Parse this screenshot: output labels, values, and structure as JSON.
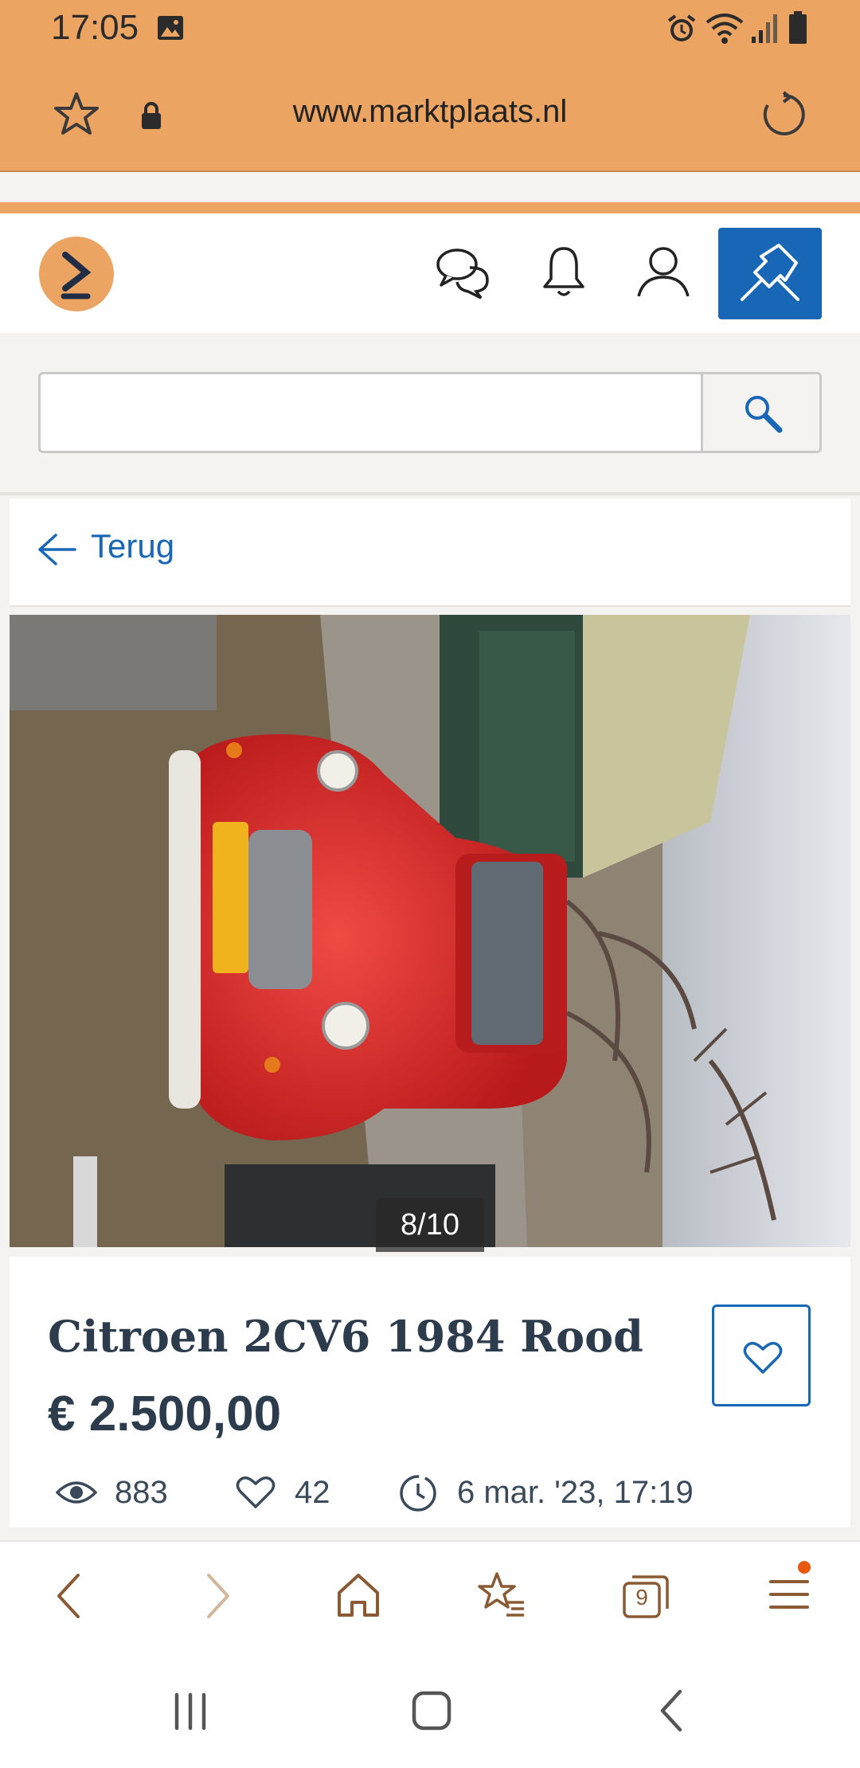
{
  "status_bar": {
    "time": "17:05",
    "icons": [
      "image-icon",
      "alarm-icon",
      "wifi-icon",
      "signal-icon",
      "battery-icon"
    ]
  },
  "url_bar": {
    "url": "www.marktplaats.nl",
    "icons": [
      "star-icon",
      "lock-icon",
      "reload-icon"
    ]
  },
  "site_header": {
    "icons": [
      "marktplaats-logo",
      "chat-icon",
      "bell-icon",
      "user-icon",
      "pin-icon"
    ],
    "colors": {
      "accent": "#1867b6",
      "logo": "#eca463"
    }
  },
  "search": {
    "placeholder": "",
    "icon": "search-icon"
  },
  "back": {
    "label": "Terug"
  },
  "gallery": {
    "counter": "8/10"
  },
  "listing": {
    "title": "Citroen 2CV6 1984 Rood",
    "price": "€ 2.500,00",
    "views": "883",
    "favorites": "42",
    "date": "6 mar. '23, 17:19"
  },
  "browser_nav": {
    "icons": [
      "back-icon",
      "forward-icon",
      "home-icon",
      "bookmarks-icon",
      "tabs-icon",
      "menu-icon"
    ],
    "tab_count": "9"
  },
  "system_nav": {
    "icons": [
      "recent-apps-icon",
      "home-button-icon",
      "system-back-icon"
    ]
  }
}
